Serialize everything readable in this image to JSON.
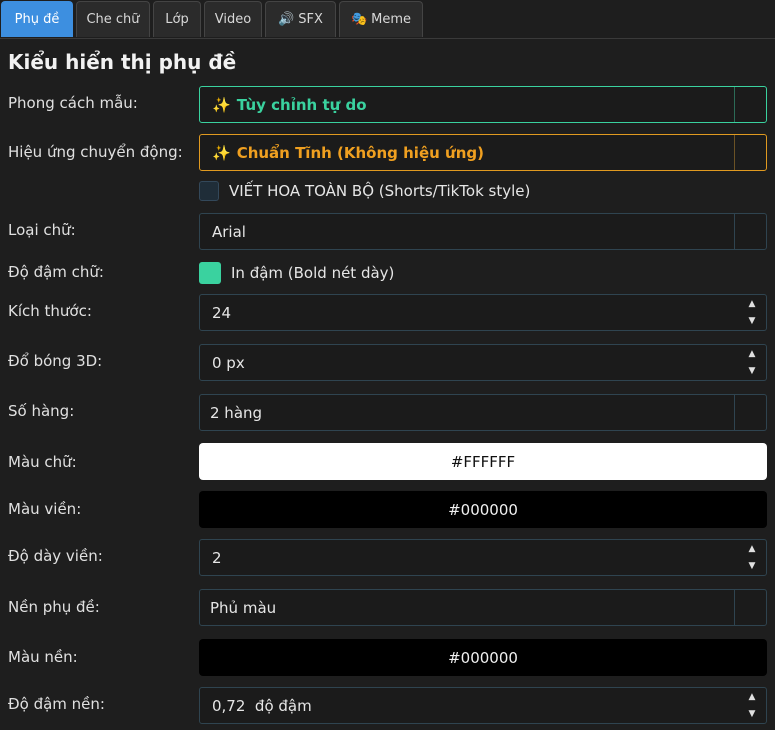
{
  "tabs": [
    {
      "label": "Phụ đề",
      "icon": ""
    },
    {
      "label": "Che chữ",
      "icon": ""
    },
    {
      "label": "Lớp",
      "icon": ""
    },
    {
      "label": "Video",
      "icon": ""
    },
    {
      "label": "SFX",
      "icon": "🔊"
    },
    {
      "label": "Meme",
      "icon": "🎭"
    }
  ],
  "heading": "Kiểu hiển thị phụ đề",
  "labels": {
    "style": "Phong cách mẫu:",
    "effect": "Hiệu ứng chuyển động:",
    "font": "Loại chữ:",
    "weight": "Độ đậm chữ:",
    "size": "Kích thước:",
    "shadow": "Đổ bóng 3D:",
    "rows": "Số hàng:",
    "text_color": "Màu chữ:",
    "outline_color": "Màu viền:",
    "outline_width": "Độ dày viền:",
    "bg": "Nền phụ đề:",
    "bg_color": "Màu nền:",
    "bg_opacity": "Độ đậm nền:"
  },
  "values": {
    "style_icon": "✨",
    "style": "Tùy chỉnh tự do",
    "effect_icon": "✨",
    "effect": "Chuẩn Tĩnh (Không hiệu ứng)",
    "uppercase": "VIẾT HOA TOÀN BỘ (Shorts/TikTok style)",
    "uppercase_checked": false,
    "font": "Arial",
    "bold": "In đậm (Bold nét dày)",
    "bold_checked": true,
    "size": "24",
    "shadow": "0 px",
    "rows": "2 hàng",
    "text_color": "#FFFFFF",
    "outline_color": "#000000",
    "outline_width": "2",
    "bg": "Phủ màu",
    "bg_color": "#000000",
    "bg_opacity": "0,72  độ đậm"
  },
  "colors": {
    "accent_tab": "#3d8fe0",
    "style_text": "#3ad29f",
    "effect_text": "#f0a020",
    "checked": "#3ad29f"
  }
}
